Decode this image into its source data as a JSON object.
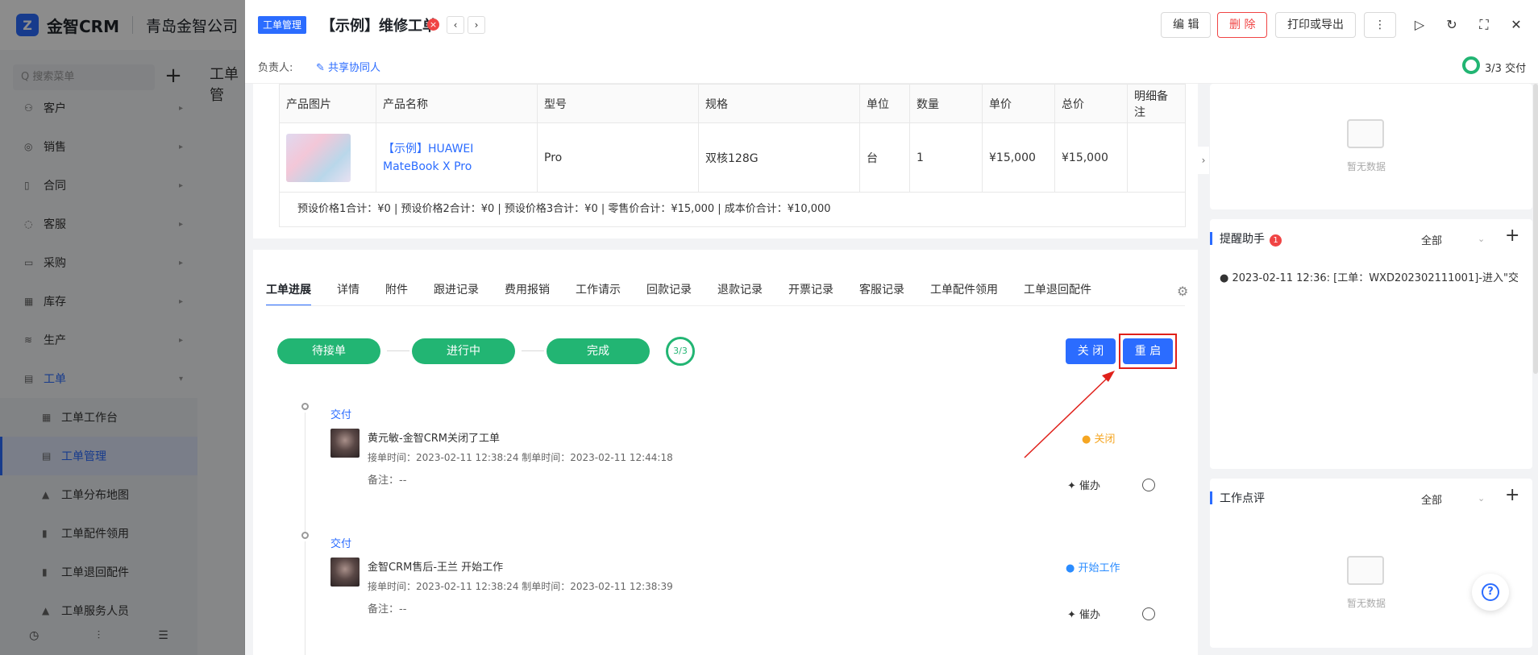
{
  "app": {
    "logo_mark": "Z",
    "name": "金智CRM",
    "company": "青岛金智公司"
  },
  "sidebar": {
    "search_placeholder": "Q 搜索菜单",
    "add": "+",
    "menu": [
      {
        "label": "客户",
        "icon": "customer-icon",
        "glyph": "⚇"
      },
      {
        "label": "销售",
        "icon": "sales-icon",
        "glyph": "◎"
      },
      {
        "label": "合同",
        "icon": "contract-icon",
        "glyph": "▯"
      },
      {
        "label": "客服",
        "icon": "service-icon",
        "glyph": "◌"
      },
      {
        "label": "采购",
        "icon": "purchase-icon",
        "glyph": "▭"
      },
      {
        "label": "库存",
        "icon": "inventory-icon",
        "glyph": "▦"
      },
      {
        "label": "生产",
        "icon": "production-icon",
        "glyph": "≋"
      },
      {
        "label": "工单",
        "icon": "workorder-icon",
        "glyph": "▤"
      }
    ],
    "submenu": [
      {
        "label": "工单工作台",
        "icon": "workbench-icon"
      },
      {
        "label": "工单管理",
        "icon": "workorder-manage-icon"
      },
      {
        "label": "工单分布地图",
        "icon": "map-icon"
      },
      {
        "label": "工单配件领用",
        "icon": "parts-icon"
      },
      {
        "label": "工单退回配件",
        "icon": "return-icon"
      },
      {
        "label": "工单服务人员",
        "icon": "staff-icon"
      }
    ],
    "ghost_title": "工单管"
  },
  "drawer": {
    "tag": "工单管理",
    "title": "【示例】维修工单",
    "prev": "‹",
    "next": "›",
    "buttons": {
      "edit": "编 辑",
      "delete": "删 除",
      "print": "打印或导出",
      "more": "⋮"
    },
    "owner_label": "负责人:",
    "share_label": "共享协同人",
    "progress": "3/3",
    "progress_stage": "交付"
  },
  "product_table": {
    "columns": [
      "产品图片",
      "产品名称",
      "型号",
      "规格",
      "单位",
      "数量",
      "单价",
      "总价",
      "明细备注"
    ],
    "rows": [
      {
        "name": "【示例】HUAWEI MateBook X Pro",
        "model": "Pro",
        "spec": "双核128G",
        "unit": "台",
        "qty": "1",
        "price": "¥15,000",
        "total": "¥15,000",
        "note": ""
      }
    ],
    "totals": "预设价格1合计：¥0 |   预设价格2合计：¥0 |   预设价格3合计：¥0 |   零售价合计：¥15,000 |   成本价合计：¥10,000"
  },
  "tabs": [
    "工单进展",
    "详情",
    "附件",
    "跟进记录",
    "费用报销",
    "工作请示",
    "回款记录",
    "退款记录",
    "开票记录",
    "客服记录",
    "工单配件领用",
    "工单退回配件"
  ],
  "stages": [
    "待接单",
    "进行中",
    "完成"
  ],
  "stage_count": "3/3",
  "actions": {
    "close": "关 闭",
    "reopen": "重 启"
  },
  "timeline": [
    {
      "stage": "交付",
      "text": "黄元敏-金智CRM关闭了工单",
      "times": "接单时间：2023-02-11 12:38:24  制单时间：2023-02-11 12:44:18",
      "note": "备注：--",
      "status": "● 关闭",
      "status_color": "#f5a623",
      "urge": "催办"
    },
    {
      "stage": "交付",
      "text": "金智CRM售后-王兰 开始工作",
      "times": "接单时间：2023-02-11 12:38:24  制单时间：2023-02-11 12:38:39",
      "note": "备注：--",
      "status": "● 开始工作",
      "status_color": "#2b8cff",
      "urge": "催办"
    }
  ],
  "right": {
    "empty_text": "暂无数据",
    "reminder": {
      "title": "提醒助手",
      "badge": "1",
      "filter": "全部",
      "add": "+",
      "item": "● 2023-02-11 12:36: [工单：WXD202302111001]-进入\"交..."
    },
    "review": {
      "title": "工作点评",
      "filter": "全部",
      "add": "+"
    }
  },
  "colors": {
    "accent": "#2b6cff",
    "stage_green": "#22b573",
    "danger": "#f04444",
    "highlight": "#e0201a"
  }
}
